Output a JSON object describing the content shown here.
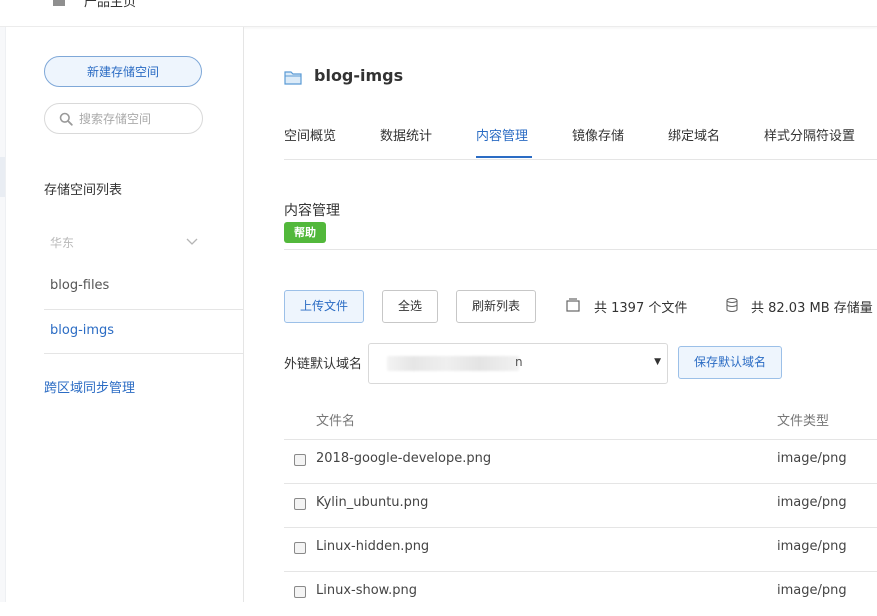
{
  "topbar": {
    "breadcrumb": "产品主页"
  },
  "sidebar": {
    "new_bucket_button": "新建存储空间",
    "search_placeholder": "搜索存储空间",
    "list_title": "存储空间列表",
    "region": "华东",
    "buckets": [
      "blog-files",
      "blog-imgs"
    ],
    "active_bucket": "blog-imgs",
    "sync_link": "跨区域同步管理"
  },
  "main": {
    "bucket_title": "blog-imgs",
    "tabs": [
      "空间概览",
      "数据统计",
      "内容管理",
      "镜像存储",
      "绑定域名",
      "样式分隔符设置"
    ],
    "active_tab": "内容管理",
    "section_title": "内容管理",
    "help_badge": "帮助",
    "toolbar": {
      "upload": "上传文件",
      "select_all": "全选",
      "refresh": "刷新列表",
      "file_count": "共 1397 个文件",
      "storage": "共 82.03 MB 存储量"
    },
    "domain": {
      "label": "外链默认域名",
      "value_visible": "n",
      "save_button": "保存默认域名"
    },
    "table": {
      "headers": [
        "文件名",
        "文件类型"
      ],
      "rows": [
        {
          "name": "2018-google-develope.png",
          "type": "image/png"
        },
        {
          "name": "Kylin_ubuntu.png",
          "type": "image/png"
        },
        {
          "name": "Linux-hidden.png",
          "type": "image/png"
        },
        {
          "name": "Linux-show.png",
          "type": "image/png"
        }
      ]
    }
  },
  "colors": {
    "accent": "#2b6cc4",
    "help_green": "#52b83b",
    "border": "#e5e5e5"
  }
}
